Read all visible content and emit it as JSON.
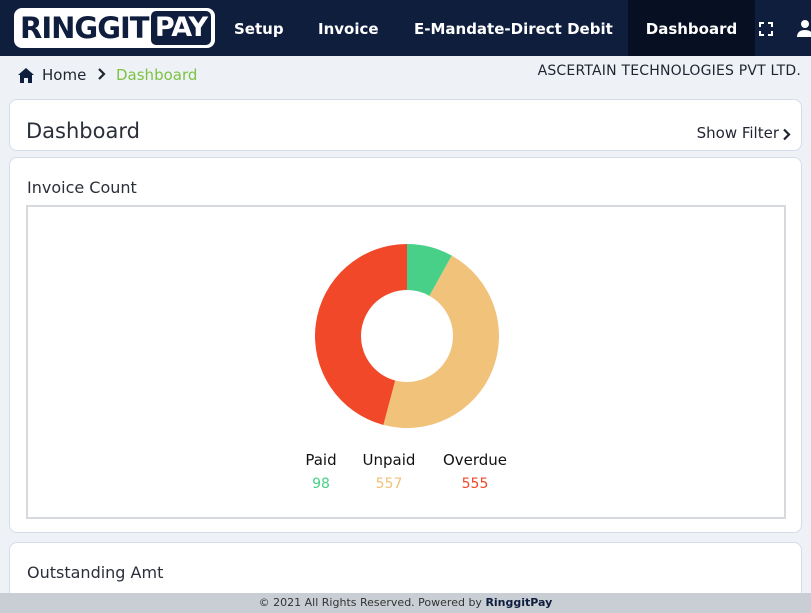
{
  "brand": {
    "logo_left": "RINGGIT",
    "logo_right": "PAY"
  },
  "nav": {
    "items": [
      {
        "label": "Setup"
      },
      {
        "label": "Invoice"
      },
      {
        "label": "E-Mandate-Direct Debit"
      },
      {
        "label": "Dashboard",
        "active": true
      }
    ],
    "icons": [
      "fullscreen-icon",
      "user-icon"
    ]
  },
  "breadcrumb": {
    "home": "Home",
    "current": "Dashboard",
    "separator_icon": "chevron-right-icon"
  },
  "company": "ASCERTAIN TECHNOLOGIES PVT LTD.",
  "header": {
    "title": "Dashboard",
    "filter_label": "Show Filter"
  },
  "invoice_count": {
    "title": "Invoice Count",
    "chart_data": {
      "type": "pie",
      "series": [
        {
          "name": "Paid",
          "value": 98,
          "color": "#48d089"
        },
        {
          "name": "Unpaid",
          "value": 557,
          "color": "#f0c27a"
        },
        {
          "name": "Overdue",
          "value": 555,
          "color": "#f04828"
        }
      ]
    }
  },
  "outstanding": {
    "title": "Outstanding Amt"
  },
  "footer": {
    "text": "© 2021 All Rights Reserved. Powered by ",
    "brand": "RinggitPay"
  },
  "colors": {
    "nav_bg": "#0f1e3d",
    "accent_green": "#7dc242"
  }
}
